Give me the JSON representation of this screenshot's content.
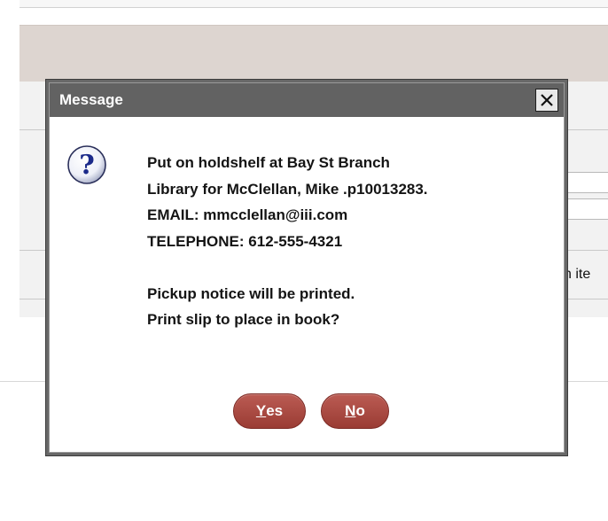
{
  "background": {
    "partial_label": "n ite"
  },
  "dialog": {
    "title": "Message",
    "icon": "question-icon",
    "close_icon": "close-icon",
    "message_lines": [
      "Put on holdshelf at Bay St Branch",
      "Library for McClellan, Mike  .p10013283.",
      "EMAIL: mmcclellan@iii.com",
      "TELEPHONE: 612-555-4321",
      "",
      "Pickup notice will be printed.",
      "Print slip to place in book?"
    ],
    "buttons": {
      "yes": {
        "mnemonic": "Y",
        "rest": "es"
      },
      "no": {
        "mnemonic": "N",
        "rest": "o"
      }
    }
  },
  "colors": {
    "titlebar": "#626262",
    "button": "#a6443c",
    "background_band": "#ddd5d0"
  }
}
